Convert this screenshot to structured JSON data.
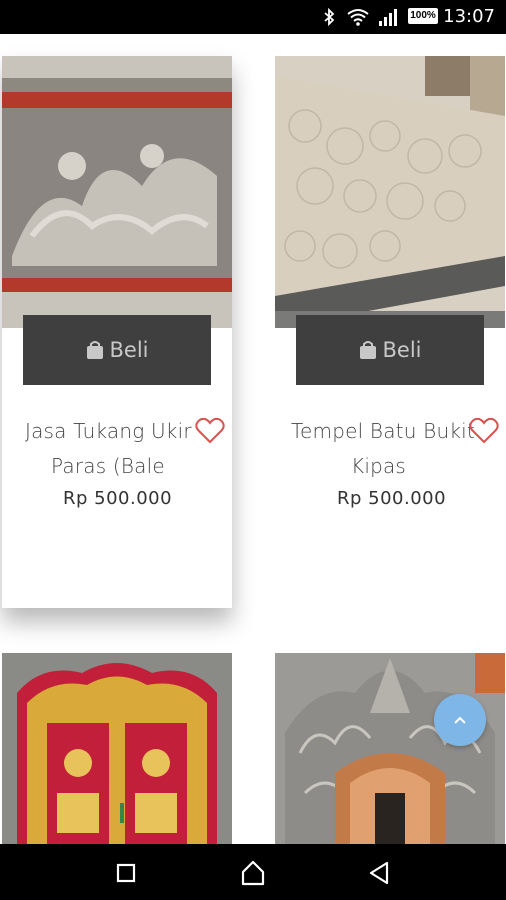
{
  "status_bar": {
    "time": "13:07",
    "battery": "100%",
    "icons": [
      "bluetooth-icon",
      "wifi-icon",
      "signal-icon",
      "battery-icon"
    ]
  },
  "products": [
    {
      "title_line1": "Jasa Tukang Ukir",
      "title_line2": "Paras (Bale",
      "price": "Rp 500.000",
      "buy_label": "Beli",
      "image": "carved stone relief"
    },
    {
      "title_line1": "Tempel Batu Bukit",
      "title_line2": "Kipas",
      "price": "Rp 500.000",
      "buy_label": "Beli",
      "image": "stone wall cladding"
    },
    {
      "image": "red and gold carved door"
    },
    {
      "image": "carved stone gate with wooden door"
    }
  ],
  "scroll_top_icon": "chevron-up-icon",
  "nav_bar": {
    "icons": [
      "recent-apps-icon",
      "home-icon",
      "back-icon"
    ]
  },
  "colors": {
    "buy_button": "#3f3f3f",
    "heart": "#d9534f",
    "fab": "#7fb6e8"
  }
}
